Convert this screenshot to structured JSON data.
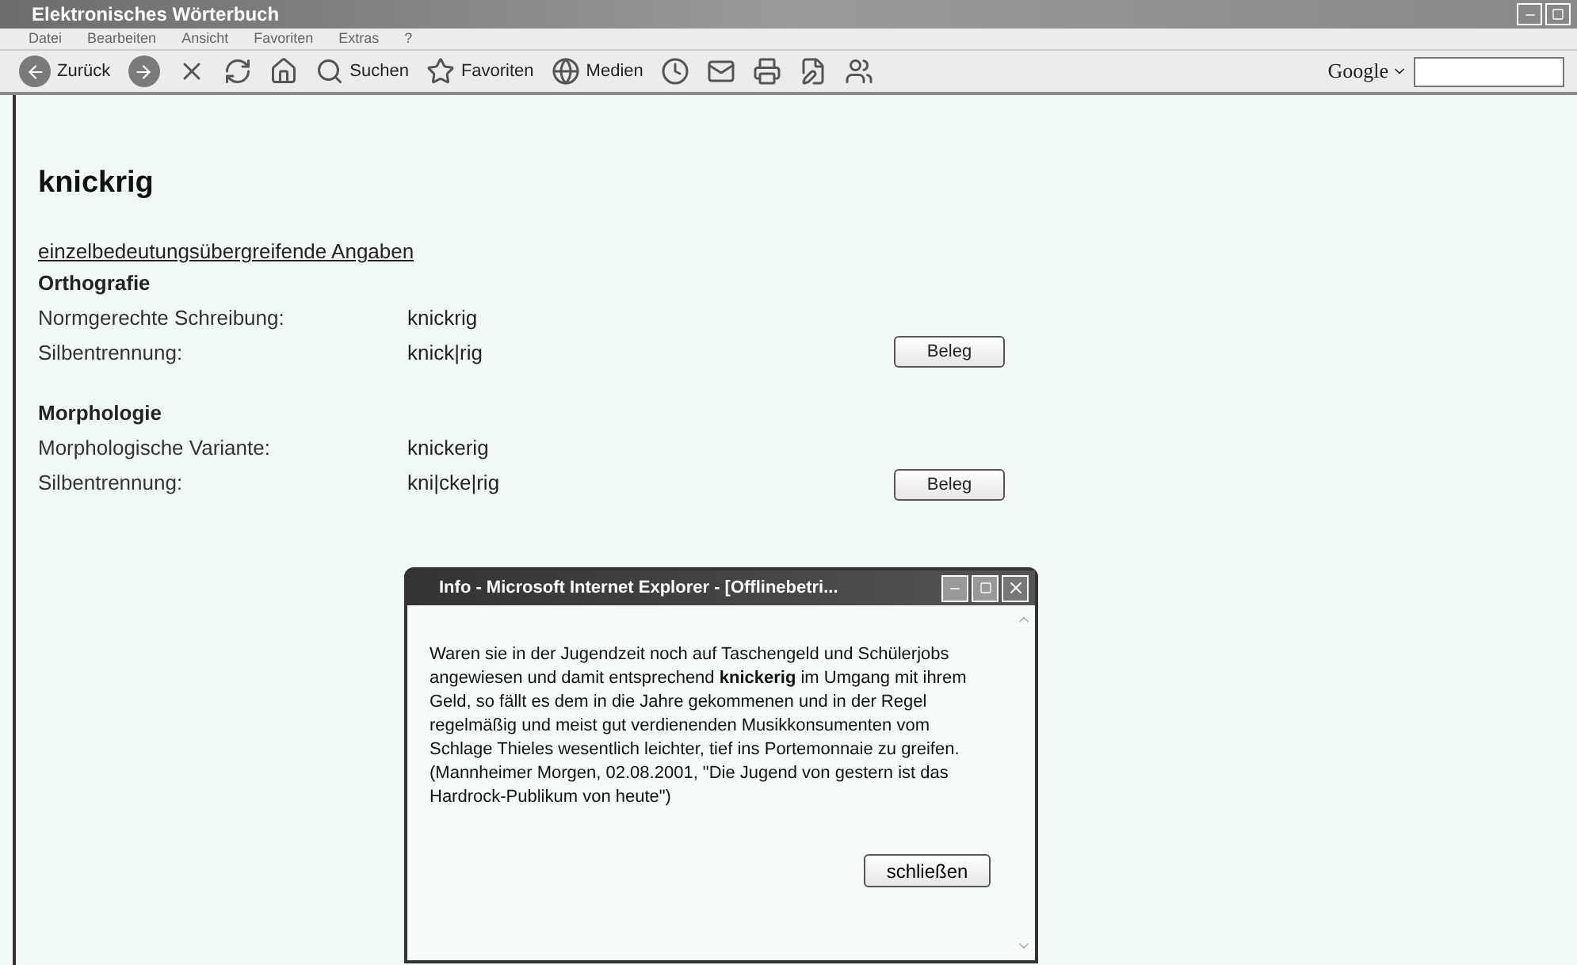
{
  "window": {
    "title": "Elektronisches Wörterbuch"
  },
  "menu": [
    "Datei",
    "Bearbeiten",
    "Ansicht",
    "Favoriten",
    "Extras",
    "?"
  ],
  "toolbar": [
    {
      "kind": "back",
      "label": "Zurück"
    },
    {
      "kind": "forward"
    },
    {
      "kind": "stop"
    },
    {
      "kind": "refresh"
    },
    {
      "kind": "home"
    },
    {
      "kind": "search",
      "label": "Suchen"
    },
    {
      "kind": "favorites",
      "label": "Favoriten"
    },
    {
      "kind": "media",
      "label": "Medien"
    },
    {
      "kind": "history"
    },
    {
      "kind": "mail"
    },
    {
      "kind": "print"
    },
    {
      "kind": "edit"
    },
    {
      "kind": "messenger"
    }
  ],
  "google": {
    "label": "Google"
  },
  "entry": {
    "headword": "knickrig",
    "link": "einzelbedeutungsübergreifende Angaben",
    "sections": [
      {
        "title": "Orthografie",
        "button": "Beleg",
        "rows": [
          {
            "label": "Normgerechte Schreibung:",
            "value": "knickrig"
          },
          {
            "label": "Silbentrennung:",
            "value": "knick|rig"
          }
        ]
      },
      {
        "title": "Morphologie",
        "button": "Beleg",
        "rows": [
          {
            "label": "Morphologische Variante:",
            "value": "knickerig"
          },
          {
            "label": "Silbentrennung:",
            "value": "kni|cke|rig"
          }
        ]
      }
    ]
  },
  "dialog": {
    "title": "Info - Microsoft Internet Explorer - [Offlinebetri...",
    "text": "Waren sie in der Jugendzeit noch auf Taschengeld und Schülerjobs angewiesen und damit entsprechend **knickerig** im Umgang mit ihrem Geld, so fällt es dem in die Jahre gekommenen und in der Regel regelmäßig und meist gut verdienenden Musikkonsumenten vom Schlage Thieles wesentlich leichter, tief ins Portemonnaie zu greifen. (Mannheimer Morgen, 02.08.2001, \"Die Jugend von gestern ist das Hardrock-Publikum von heute\")",
    "button": "schließen"
  }
}
